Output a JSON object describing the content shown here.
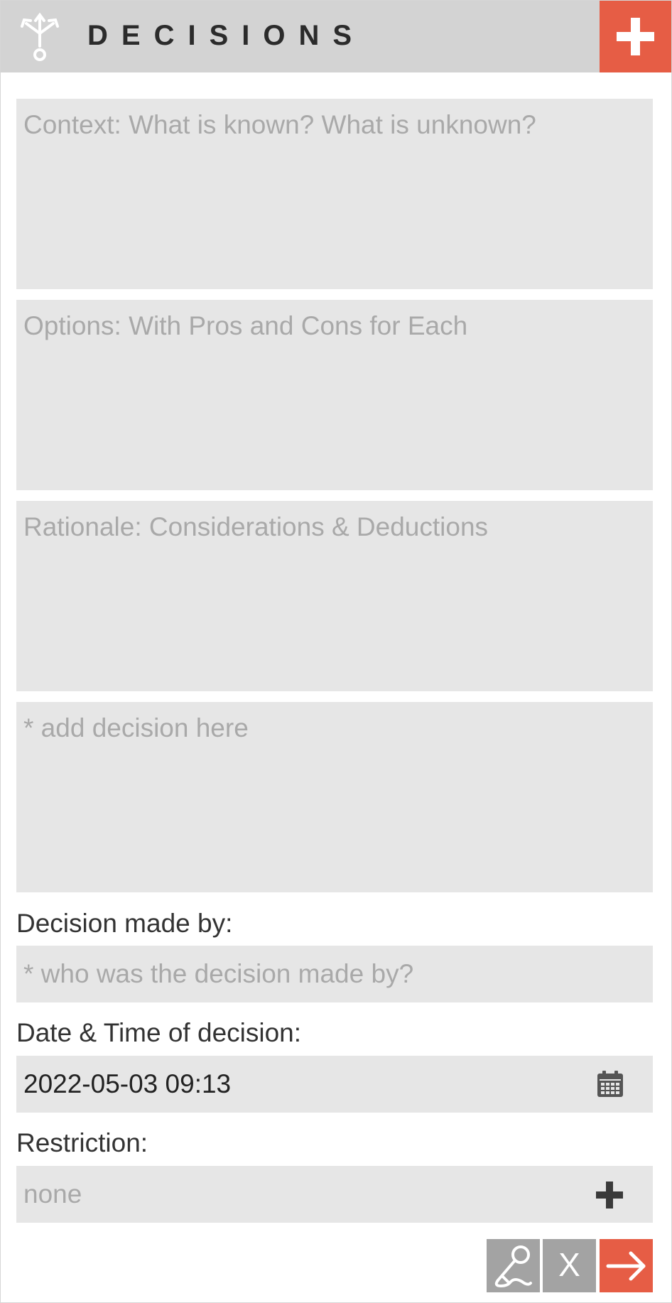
{
  "header": {
    "title": "DECISIONS",
    "icon": "decision-branch-icon",
    "add_icon": "plus-icon"
  },
  "fields": {
    "context_placeholder": "Context: What is known? What is unknown?",
    "options_placeholder": "Options: With Pros and Cons for Each",
    "rationale_placeholder": "Rationale: Considerations & Deductions",
    "decision_placeholder": "* add decision here"
  },
  "made_by": {
    "label": "Decision made by:",
    "placeholder": "* who was the decision made by?"
  },
  "datetime": {
    "label": "Date & Time of decision:",
    "value": "2022-05-03 09:13",
    "icon": "calendar-icon"
  },
  "restriction": {
    "label": "Restriction:",
    "value": "none",
    "icon": "plus-icon"
  },
  "footer": {
    "mic_icon": "microphone-icon",
    "cancel_label": "X",
    "submit_icon": "arrow-right-icon"
  },
  "colors": {
    "accent": "#e65d45",
    "header_bg": "#d3d3d3",
    "field_bg": "#e6e6e6",
    "button_gray": "#a3a3a3"
  }
}
